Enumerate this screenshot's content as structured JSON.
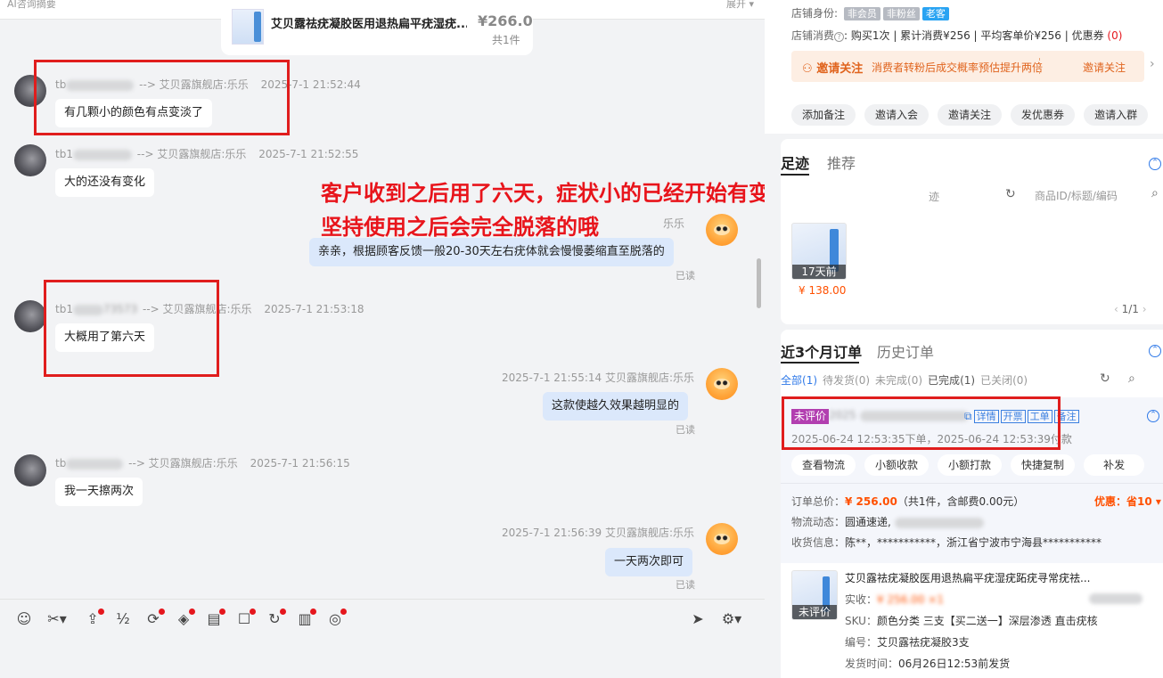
{
  "chat": {
    "summary_label": "AI咨询摘要",
    "expand_label": "展开",
    "product": {
      "title": "艾贝露祛疣凝胶医用退热扁平疣湿疣...",
      "price": "¥266.0",
      "count": "共1件"
    },
    "messages": [
      {
        "from": "customer",
        "sender_prefix": "tb",
        "shop": "--> 艾贝露旗舰店:乐乐",
        "time": "2025-7-1 21:52:44",
        "text": "有几颗小的颜色有点变淡了"
      },
      {
        "from": "customer",
        "sender_prefix": "tb1",
        "shop": "--> 艾贝露旗舰店:乐乐",
        "time": "2025-7-1 21:52:55",
        "text": "大的还没有变化"
      },
      {
        "from": "agent",
        "header": "乐乐",
        "text": "亲亲，根据顾客反馈一般20-30天左右疣体就会慢慢萎缩直至脱落的",
        "status": "已读"
      },
      {
        "from": "customer",
        "sender_prefix": "tb1",
        "sender_suffix": "73573",
        "shop": "--> 艾贝露旗舰店:乐乐",
        "time": "2025-7-1 21:53:18",
        "text": "大概用了第六天"
      },
      {
        "from": "agent",
        "header": "2025-7-1 21:55:14 艾贝露旗舰店:乐乐",
        "text": "这款使越久效果越明显的",
        "status": "已读"
      },
      {
        "from": "customer",
        "sender_prefix": "tb",
        "shop": "--> 艾贝露旗舰店:乐乐",
        "time": "2025-7-1 21:56:15",
        "text": "我一天擦两次"
      },
      {
        "from": "agent",
        "header": "2025-7-1 21:56:39 艾贝露旗舰店:乐乐",
        "text": "一天两次即可",
        "status": "已读"
      }
    ],
    "annotation": {
      "line1": "客户收到之后用了六天，症状小的已经开始有变化了",
      "line2": "坚持使用之后会完全脱落的哦"
    },
    "toolbar_icons": [
      "emoji-icon",
      "scissors-icon",
      "upload-icon",
      "fraction-icon",
      "refresh-coin-icon",
      "tag-icon",
      "clipboard-icon",
      "add-card-icon",
      "rotate-icon",
      "receipt-icon",
      "search-bulb-icon",
      "send-circle-icon",
      "settings-gear-icon"
    ]
  },
  "right": {
    "store": {
      "identity_label": "店铺身份:",
      "tags": [
        "非会员",
        "非粉丝",
        "老客"
      ],
      "consume_label": "店铺消费",
      "consume_q": "?",
      "consume_text": ": 购买1次 | 累计消费¥256 | 平均客单价¥256 | 优惠券 ",
      "coupon_count": "(0)",
      "banner_title": "邀请关注",
      "banner_text": "消费者转粉后成交概率预估提升两倍",
      "banner_btn": "邀请关注",
      "actions": [
        "添加备注",
        "邀请入会",
        "邀请关注",
        "发优惠券",
        "邀请入群"
      ]
    },
    "footprint": {
      "tab_active": "足迹",
      "tab_other": "推荐",
      "partial_label": "迹",
      "search_placeholder": "商品ID/标题/编码",
      "item_badge": "17天前",
      "item_price": "¥ 138.00",
      "pagination": "1/1"
    },
    "orders": {
      "tab_active": "近3个月订单",
      "tab_other": "历史订单",
      "filters": [
        {
          "label": "全部",
          "count": "(1)",
          "active": true
        },
        {
          "label": "待发货",
          "count": "(0)",
          "active": false
        },
        {
          "label": "未完成",
          "count": "(0)",
          "active": false
        },
        {
          "label": "已完成",
          "count": "(1)",
          "active": false
        },
        {
          "label": "已关闭",
          "count": "(0)",
          "active": false
        }
      ],
      "status_badge": "未评价",
      "order_no_prefix": "2025",
      "links": [
        "详情",
        "开票",
        "工单",
        "备注"
      ],
      "time_text": "2025-06-24 12:53:35下单，2025-06-24 12:53:39付款",
      "buttons": [
        "查看物流",
        "小额收款",
        "小额打款",
        "快捷复制",
        "补发"
      ],
      "total_label": "订单总价：",
      "total_value": "¥ 256.00",
      "total_detail": "（共1件，含邮费0.00元）",
      "discount": "优惠：省10",
      "logistics_label": "物流动态：",
      "logistics_value": "圆通速递,",
      "address_label": "收货信息：",
      "address_value": "陈**，***********，浙江省宁波市宁海县***********",
      "item": {
        "title": "艾贝露祛疣凝胶医用退热扁平疣湿疣跖疣寻常疣祛...",
        "paid_label": "实收：",
        "paid_value": "¥ 256.00 ×1",
        "badge": "未评价",
        "sku_label": "SKU：",
        "sku_value": "颜色分类 三支【买二送一】深层渗透 直击疣核",
        "code_label": "编号：",
        "code_value": "艾贝露祛疣凝胶3支",
        "ship_label": "发货时间：",
        "ship_value": "06月26日12:53前发货"
      }
    }
  },
  "colors": {
    "accent": "#2f79e8",
    "price": "#ff5000",
    "annotation": "#e8141b",
    "box": "#e01d1d"
  }
}
